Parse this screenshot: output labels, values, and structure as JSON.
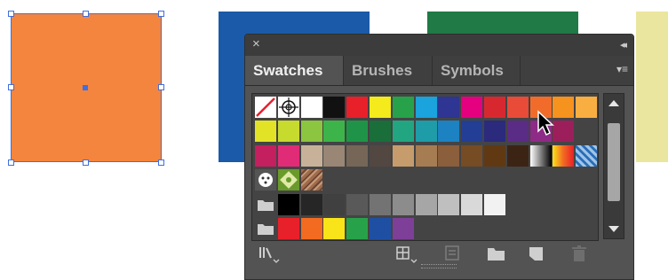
{
  "canvas": {
    "colors": {
      "orange": "#F3853F",
      "blue": "#1B5AA8",
      "green": "#1F7A45",
      "yellow": "#EBE69F",
      "selection": "#3F6FE0"
    }
  },
  "panel": {
    "close_glyph": "×",
    "collapse_glyph": "◂◂",
    "tabs": [
      {
        "label": "Swatches",
        "active": true
      },
      {
        "label": "Brushes",
        "active": false
      },
      {
        "label": "Symbols",
        "active": false
      }
    ],
    "menu_glyph": "▾≡",
    "swatch_rows": [
      [
        "none",
        "registration",
        "#FFFFFF",
        "#111111",
        "#E8202A",
        "#F4EA1C",
        "#27A24A",
        "#1AA3DC",
        "#2E3592",
        "#E4007F",
        "#D7282F",
        "#E84B37",
        "#F16C2B",
        "#F6921E",
        "#F9AE42"
      ],
      [
        "#E2E327",
        "#C7DA2E",
        "#8CC540",
        "#3CB44A",
        "#1F9448",
        "#1A6E3A",
        "#22A681",
        "#1E9DA8",
        "#1C82C2",
        "#233F95",
        "#2C2A7C",
        "#5B2C86",
        "#8D2B87",
        "#9C1F5C"
      ],
      [
        "#C41F5F",
        "#E02C76",
        "#C7B299",
        "#998675",
        "#756657",
        "#534741",
        "#C69C6D",
        "#A67C52",
        "#8B5E3C",
        "#754C24",
        "#603913",
        "#3C2415",
        "gradient-bw",
        "gradient-orange",
        "gradient-blue"
      ],
      [
        "pattern-dots",
        "pattern-leaf",
        "pattern-brick"
      ],
      [
        "folder",
        "#000000",
        "#262626",
        "#404040",
        "#595959",
        "#737373",
        "#8C8C8C",
        "#A6A6A6",
        "#BFBFBF",
        "#D9D9D9",
        "#F2F2F2"
      ],
      [
        "folder",
        "#E8202A",
        "#F26B21",
        "#F9E319",
        "#27A24A",
        "#1F4FA3",
        "#7E3F98"
      ]
    ],
    "bottom_icons": [
      "swatch-libraries-menu-icon",
      "show-swatch-kinds-icon",
      "swatch-options-icon",
      "new-color-group-icon",
      "new-swatch-icon",
      "delete-swatch-icon"
    ]
  }
}
